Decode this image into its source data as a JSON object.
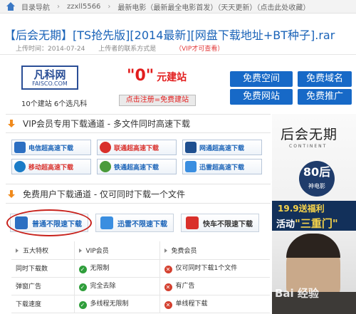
{
  "breadcrumb": {
    "items": [
      "目录导航",
      "zzxll5566",
      "最新电影（最新最全电影首发）（天天更新）（点击此处收藏）"
    ]
  },
  "page": {
    "title": "【后会无期】[TS抢先版][2014最新][网盘下载地址+BT种子].rar",
    "upload_time": "上传时间：2014-07-24",
    "uploader_contact": "上传者的联系方式是",
    "vip_note": "（VIP才可查看）"
  },
  "banner": {
    "logo_big": "凡科网",
    "logo_small": "FAISCO.COM",
    "logo_sub": "10个建站 6个选凡科",
    "zero": "\"0\"",
    "zero_text": "元建站",
    "register": "点击注册=免费建站",
    "buttons": [
      "免费空间",
      "免费域名",
      "免费网站",
      "免费推广"
    ]
  },
  "vip_channel": {
    "title": "VIP会员专用下载通道 - 多文件同时高速下载",
    "buttons": [
      "电信超高速下载",
      "联通超高速下载",
      "网通超高速下载",
      "移动超高速下载",
      "铁通超高速下载",
      "迅雷超高速下载"
    ]
  },
  "free_channel": {
    "title": "免费用户下载通道 - 仅可同时下载一个文件",
    "buttons": [
      "普通不限速下载",
      "迅雷不限速下载",
      "快车不限速下载"
    ]
  },
  "feature_table": {
    "header": [
      "五大特权",
      "VIP会员",
      "免费会员"
    ],
    "rows": [
      {
        "name": "同时下载数",
        "vip": "无限制",
        "free": "仅可同时下载1个文件"
      },
      {
        "name": "弹窗广告",
        "vip": "完全去除",
        "free": "有广告"
      },
      {
        "name": "下载速度",
        "vip": "多线程无限制",
        "free": "单线程下载"
      }
    ]
  },
  "poster": {
    "title": "后会无期",
    "subtitle": "CONTINENT",
    "badge_num": "80后",
    "badge_text": "神电影",
    "line1": "19.9送福利",
    "line2a": "活动",
    "line2b": "\"三重门\""
  },
  "watermark": "Bai 经验"
}
